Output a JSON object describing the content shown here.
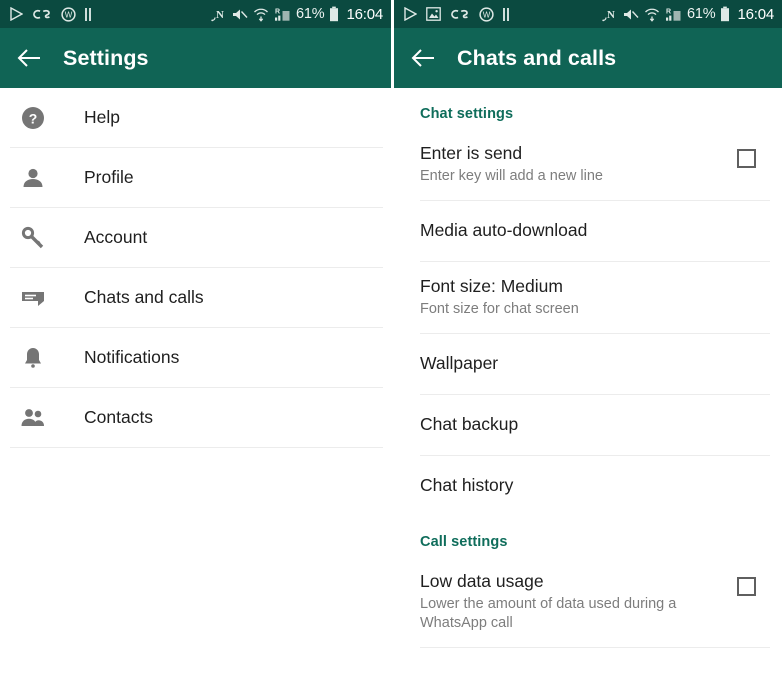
{
  "theme": {
    "statusbar_bg": "#0b4a40",
    "toolbar_bg": "#106455",
    "accent_teal": "#0f6d5b",
    "page_bg": "#ffffff",
    "divider": "#ececec",
    "primary_text": "#1f1f1f",
    "secondary_text": "#7d7d7d",
    "icon_gray": "#757575"
  },
  "left_screen": {
    "statusbar": {
      "left_icons": [
        "play-icon",
        "lastfm-icon",
        "whatsapp-badge-icon",
        "pause-icon"
      ],
      "right_icons": [
        "nfc-icon",
        "mute-icon",
        "wifi-icon",
        "signal-roaming-icon"
      ],
      "battery_percent": "61%",
      "battery_icon": "battery-icon",
      "clock": "16:04"
    },
    "toolbar": {
      "back_icon": "back-arrow-icon",
      "title": "Settings"
    },
    "items": [
      {
        "label": "Help",
        "icon": "help-circle-icon"
      },
      {
        "label": "Profile",
        "icon": "person-icon"
      },
      {
        "label": "Account",
        "icon": "key-icon"
      },
      {
        "label": "Chats and calls",
        "icon": "chat-bubble-icon"
      },
      {
        "label": "Notifications",
        "icon": "bell-icon"
      },
      {
        "label": "Contacts",
        "icon": "contacts-icon"
      }
    ]
  },
  "right_screen": {
    "statusbar": {
      "left_icons": [
        "play-icon",
        "screenshot-icon",
        "lastfm-icon",
        "whatsapp-badge-icon",
        "pause-icon"
      ],
      "right_icons": [
        "nfc-icon",
        "mute-icon",
        "wifi-icon",
        "signal-roaming-icon"
      ],
      "battery_percent": "61%",
      "battery_icon": "battery-icon",
      "clock": "16:04"
    },
    "toolbar": {
      "back_icon": "back-arrow-icon",
      "title": "Chats and calls"
    },
    "sections": [
      {
        "header": "Chat settings",
        "items": [
          {
            "title": "Enter is send",
            "subtitle": "Enter key will add a new line",
            "control": "checkbox",
            "checked": false
          },
          {
            "title": "Media auto-download",
            "subtitle": "",
            "control": "none"
          },
          {
            "title": "Font size: Medium",
            "subtitle": "Font size for chat screen",
            "control": "none"
          },
          {
            "title": "Wallpaper",
            "subtitle": "",
            "control": "none"
          },
          {
            "title": "Chat backup",
            "subtitle": "",
            "control": "none"
          },
          {
            "title": "Chat history",
            "subtitle": "",
            "control": "none"
          }
        ]
      },
      {
        "header": "Call settings",
        "items": [
          {
            "title": "Low data usage",
            "subtitle": "Lower the amount of data used during a WhatsApp call",
            "control": "checkbox",
            "checked": false
          }
        ]
      }
    ]
  }
}
